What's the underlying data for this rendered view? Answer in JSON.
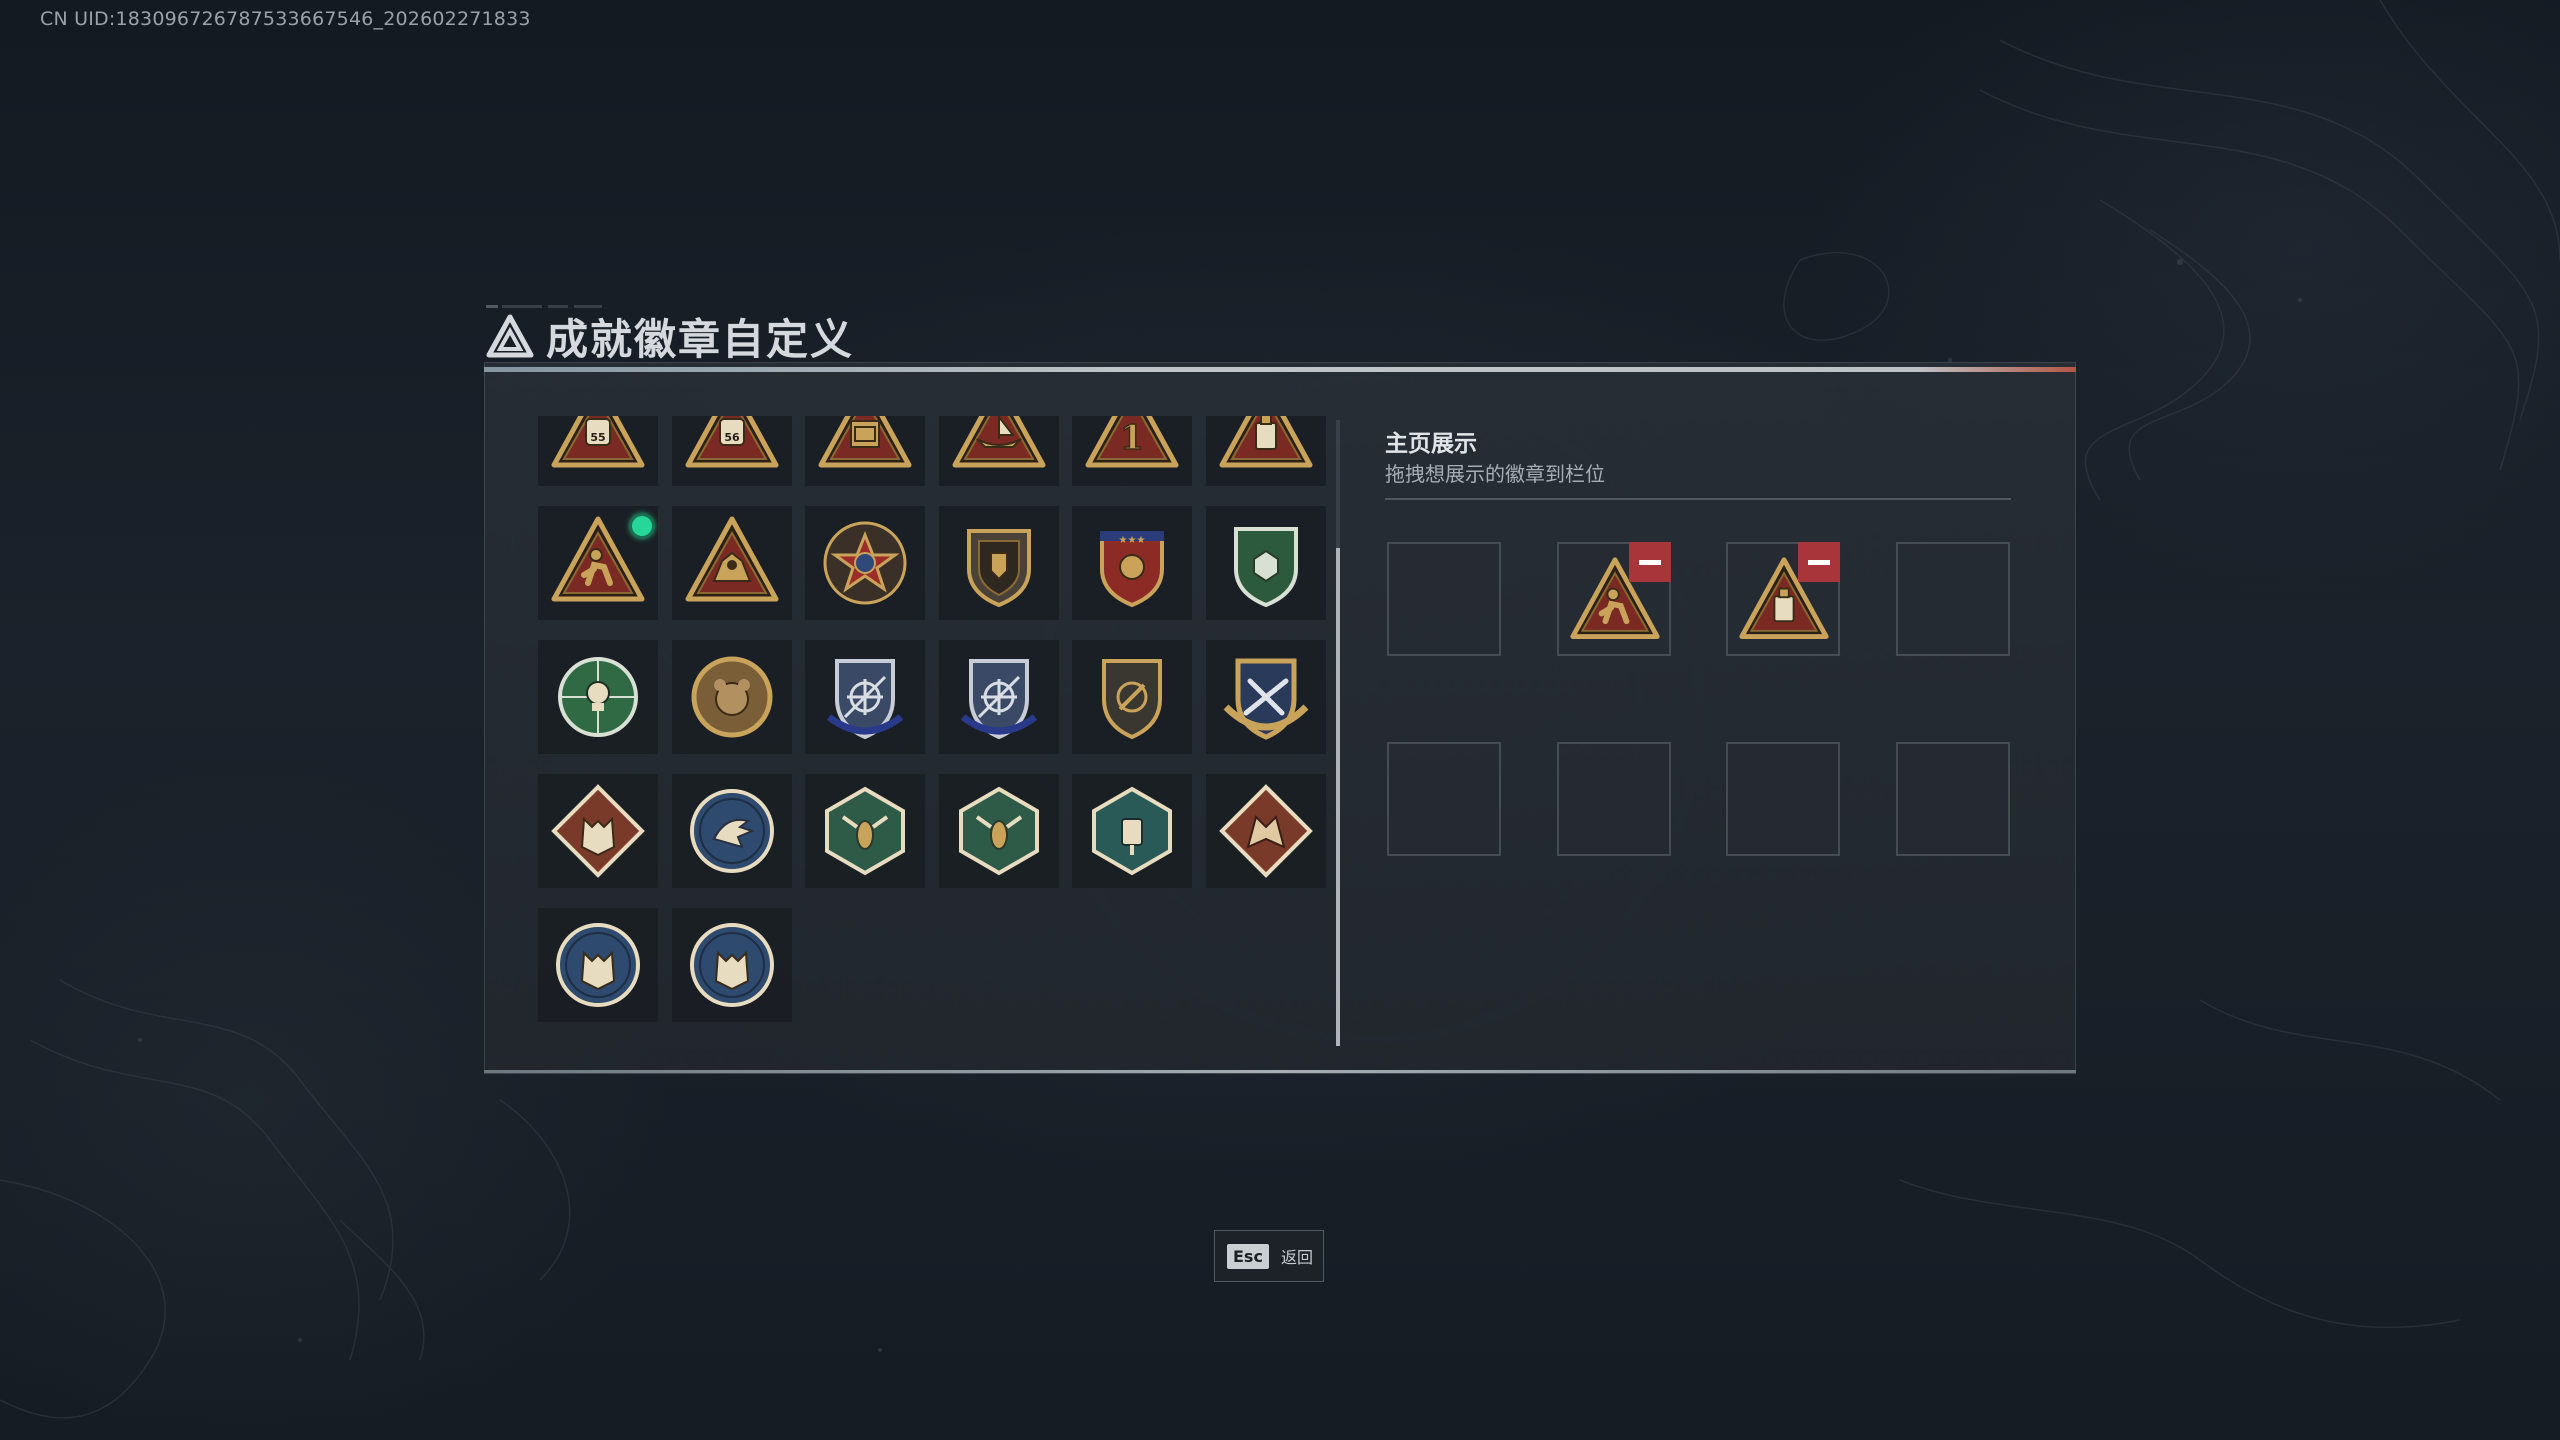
{
  "uid": "CN UID:18309672678753366754 6_202602271833",
  "uid_display": "CN UID:183096726787533667546_202602271833",
  "header": {
    "title": "成就徽章自定义"
  },
  "badges": [
    {
      "name": "badge-triangle-backpack-55",
      "shape": "triangle",
      "glyph": "55"
    },
    {
      "name": "badge-triangle-vest-56",
      "shape": "triangle",
      "glyph": "56"
    },
    {
      "name": "badge-triangle-box",
      "shape": "triangle",
      "glyph": "box"
    },
    {
      "name": "badge-triangle-boat",
      "shape": "triangle",
      "glyph": "boat"
    },
    {
      "name": "badge-triangle-number-1",
      "shape": "triangle",
      "glyph": "1"
    },
    {
      "name": "badge-triangle-bottle",
      "shape": "triangle",
      "glyph": "bottle"
    },
    {
      "name": "badge-triangle-runner",
      "shape": "triangle",
      "glyph": "runner",
      "is_new": true
    },
    {
      "name": "badge-triangle-beast",
      "shape": "triangle",
      "glyph": "beast"
    },
    {
      "name": "badge-star-medal",
      "shape": "star",
      "glyph": "star"
    },
    {
      "name": "badge-shield-emblem",
      "shape": "shield",
      "glyph": "shield"
    },
    {
      "name": "badge-shield-stars",
      "shape": "shield-red",
      "glyph": "stars"
    },
    {
      "name": "badge-shield-green-gem",
      "shape": "shield-green",
      "glyph": "gem"
    },
    {
      "name": "badge-green-skull",
      "shape": "round-green",
      "glyph": "skull"
    },
    {
      "name": "badge-round-bear",
      "shape": "round-gold",
      "glyph": "bear"
    },
    {
      "name": "badge-shield-crosshair-1",
      "shape": "shield-blue",
      "glyph": "crosshair"
    },
    {
      "name": "badge-shield-crosshair-2",
      "shape": "shield-blue",
      "glyph": "crosshair"
    },
    {
      "name": "badge-shield-compass",
      "shape": "shield-dark",
      "glyph": "compass"
    },
    {
      "name": "badge-shield-gold-rifle",
      "shape": "shield-gold",
      "glyph": "rifle"
    },
    {
      "name": "badge-diamond-wolf-red",
      "shape": "diamond-red",
      "glyph": "wolf"
    },
    {
      "name": "badge-round-eagle",
      "shape": "round-blue",
      "glyph": "eagle"
    },
    {
      "name": "badge-hex-hornet-1",
      "shape": "hex-green",
      "glyph": "hornet"
    },
    {
      "name": "badge-hex-hornet-2",
      "shape": "hex-green",
      "glyph": "hornet"
    },
    {
      "name": "badge-hex-drill",
      "shape": "hex-teal",
      "glyph": "drill"
    },
    {
      "name": "badge-diamond-dragon",
      "shape": "diamond-red",
      "glyph": "dragon"
    },
    {
      "name": "badge-round-wolf-1",
      "shape": "round-blue",
      "glyph": "wolf"
    },
    {
      "name": "badge-round-wolf-2",
      "shape": "round-blue",
      "glyph": "wolf"
    }
  ],
  "showcase": {
    "title": "主页展示",
    "subtitle": "拖拽想展示的徽章到栏位",
    "slots": [
      {
        "badge": null
      },
      {
        "badge": "badge-triangle-runner"
      },
      {
        "badge": "badge-triangle-bottle"
      },
      {
        "badge": null
      },
      {
        "badge": null
      },
      {
        "badge": null
      },
      {
        "badge": null
      },
      {
        "badge": null
      }
    ]
  },
  "footer": {
    "esc_key": "Esc",
    "esc_label": "返回"
  },
  "colors": {
    "accent_red": "#a8353a",
    "new_dot": "#27d79a",
    "badge_gold": "#c9a35a"
  }
}
